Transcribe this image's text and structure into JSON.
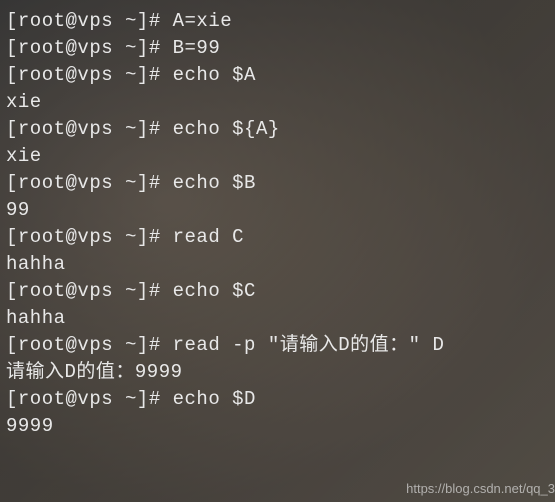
{
  "terminal": {
    "prompt": "[root@vps ~]# ",
    "lines": [
      {
        "type": "cmd",
        "text": "A=xie"
      },
      {
        "type": "cmd",
        "text": "B=99"
      },
      {
        "type": "cmd",
        "text": "echo $A"
      },
      {
        "type": "out",
        "text": "xie"
      },
      {
        "type": "cmd",
        "text": "echo ${A}"
      },
      {
        "type": "out",
        "text": "xie"
      },
      {
        "type": "cmd",
        "text": "echo $B"
      },
      {
        "type": "out",
        "text": "99"
      },
      {
        "type": "cmd",
        "text": "read C"
      },
      {
        "type": "out",
        "text": "hahha"
      },
      {
        "type": "cmd",
        "text": "echo $C"
      },
      {
        "type": "out",
        "text": "hahha"
      },
      {
        "type": "cmd",
        "text": "read -p \"请输入D的值：\" D"
      },
      {
        "type": "out",
        "text": "请输入D的值：9999"
      },
      {
        "type": "cmd",
        "text": "echo $D"
      },
      {
        "type": "out",
        "text": "9999"
      }
    ]
  },
  "watermark": "https://blog.csdn.net/qq_3"
}
